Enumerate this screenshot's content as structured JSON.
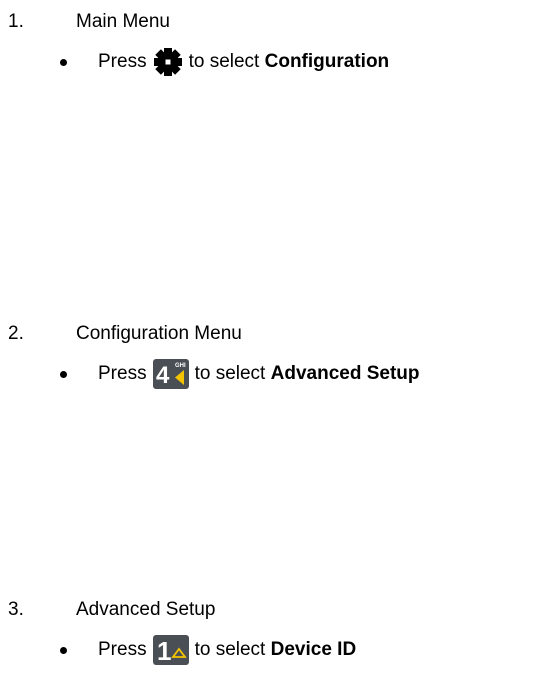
{
  "steps": [
    {
      "number": "1.",
      "title": "Main Menu",
      "press_label": "Press",
      "select_text": "to select ",
      "target": "Configuration",
      "key_icon": "gear-icon"
    },
    {
      "number": "2.",
      "title": "Configuration Menu",
      "press_label": "Press",
      "select_text": "to select ",
      "target": "Advanced Setup",
      "key_icon": "key-4-ghi-icon",
      "key_digit": "4",
      "key_letters": "GHI"
    },
    {
      "number": "3.",
      "title": "Advanced Setup",
      "press_label": "Press",
      "select_text": "to select ",
      "target": "Device ID",
      "key_icon": "key-1-icon",
      "key_digit": "1"
    }
  ],
  "colors": {
    "key_background": "#4a4f55",
    "key_digit": "#ffffff",
    "key_arrow": "#f5c400",
    "text": "#000000"
  }
}
